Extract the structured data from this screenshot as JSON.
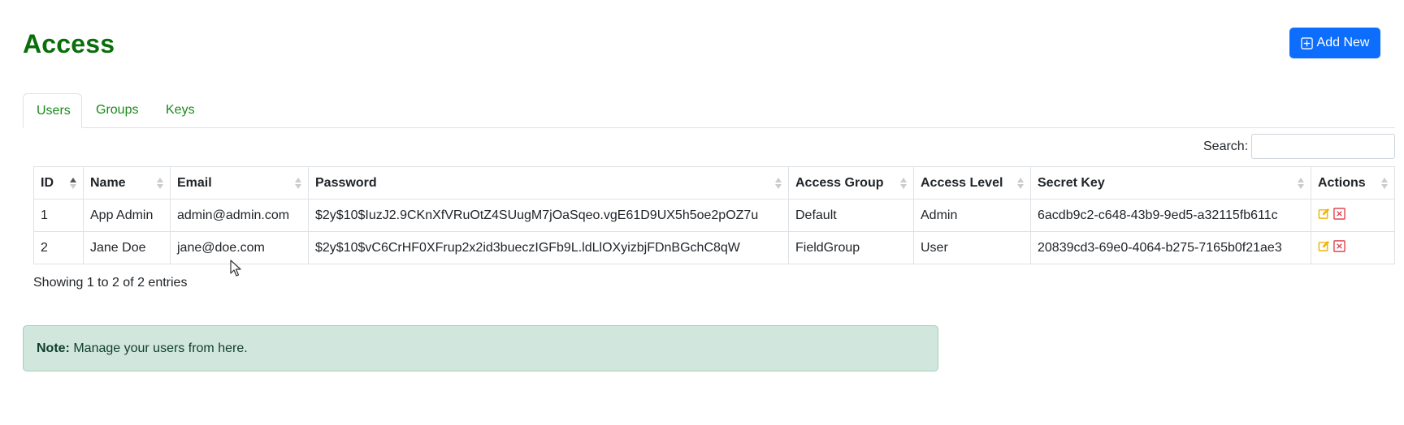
{
  "page": {
    "title": "Access"
  },
  "toolbar": {
    "add_label": "Add New"
  },
  "tabs": [
    {
      "label": "Users",
      "active": true
    },
    {
      "label": "Groups",
      "active": false
    },
    {
      "label": "Keys",
      "active": false
    }
  ],
  "search": {
    "label": "Search:",
    "value": "",
    "placeholder": ""
  },
  "table": {
    "columns": [
      "ID",
      "Name",
      "Email",
      "Password",
      "Access Group",
      "Access Level",
      "Secret Key",
      "Actions"
    ],
    "sorted_column": "ID",
    "sort_direction": "ascending",
    "rows": [
      {
        "id": "1",
        "name": "App Admin",
        "email": "admin@admin.com",
        "password": "$2y$10$IuzJ2.9CKnXfVRuOtZ4SUugM7jOaSqeo.vgE61D9UX5h5oe2pOZ7u",
        "group": "Default",
        "level": "Admin",
        "secret": "6acdb9c2-c648-43b9-9ed5-a32115fb611c"
      },
      {
        "id": "2",
        "name": "Jane Doe",
        "email": "jane@doe.com",
        "password": "$2y$10$vC6CrHF0XFrup2x2id3bueczIGFb9L.ldLlOXyizbjFDnBGchC8qW",
        "group": "FieldGroup",
        "level": "User",
        "secret": "20839cd3-69e0-4064-b275-7165b0f21ae3"
      }
    ]
  },
  "info": {
    "text": "Showing 1 to 2 of 2 entries"
  },
  "note": {
    "label": "Note:",
    "text": " Manage your users from here."
  },
  "icons": {
    "add": "plus-square-icon",
    "edit": "edit-icon",
    "delete": "delete-x-icon",
    "sort": "sort-icon",
    "cursor": "mouse-pointer-icon"
  },
  "colors": {
    "title": "#0a6e0a",
    "tab_link": "#198a19",
    "primary": "#0d6efd",
    "edit_icon": "#f0b400",
    "delete_icon": "#dc3545",
    "note_bg": "#d1e7dd"
  }
}
